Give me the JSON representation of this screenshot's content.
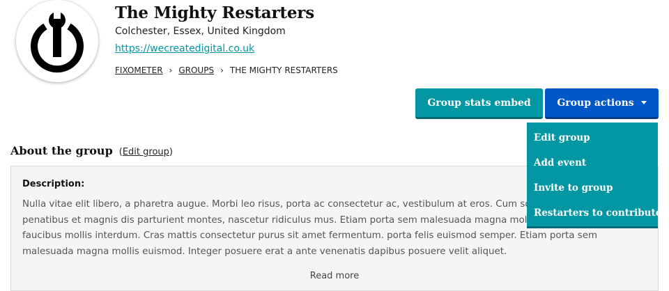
{
  "group": {
    "name": "The Mighty Restarters",
    "location": "Colchester, Essex, United Kingdom",
    "website": "https://wecreatedigital.co.uk"
  },
  "breadcrumb": {
    "items": [
      "FIXOMETER",
      "GROUPS",
      "THE MIGHTY RESTARTERS"
    ],
    "separator": "›"
  },
  "actions": {
    "stats_embed_label": "Group stats embed",
    "group_actions_label": "Group actions",
    "menu": [
      "Edit group",
      "Add event",
      "Invite to group",
      "Restarters to contribute"
    ]
  },
  "about": {
    "heading": "About the group",
    "edit_link": "Edit group",
    "description_label": "Description:",
    "description": "Nulla vitae elit libero, a pharetra augue. Morbi leo risus, porta ac consectetur ac, vestibulum at eros. Cum sociis natoque penatibus et magnis dis parturient montes, nascetur ridiculus mus. Etiam porta sem malesuada magna mollis euismod. Maecenas faucibus mollis interdum. Cras mattis consectetur purus sit amet fermentum. porta felis euismod semper. Etiam porta sem malesuada magna mollis euismod. Integer posuere erat a ante venenatis dapibus posuere velit aliquet.",
    "read_more": "Read more"
  },
  "colors": {
    "teal": "#0397a3",
    "blue": "#0057c8",
    "box_bg": "#f5f5f5"
  },
  "icons": {
    "logo": "power-wrench-icon",
    "caret": "caret-down-icon"
  }
}
